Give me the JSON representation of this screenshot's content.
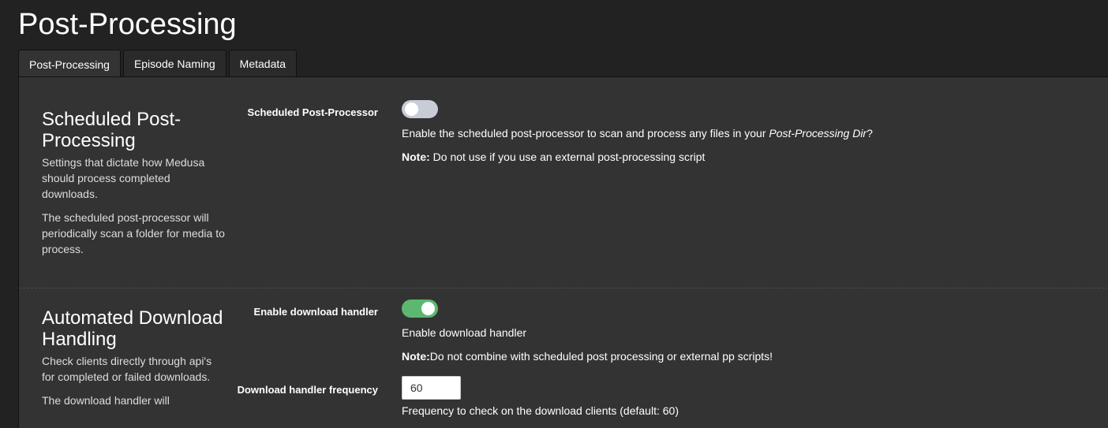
{
  "page": {
    "title": "Post-Processing"
  },
  "tabs": [
    {
      "label": "Post-Processing",
      "active": true
    },
    {
      "label": "Episode Naming",
      "active": false
    },
    {
      "label": "Metadata",
      "active": false
    }
  ],
  "scheduled": {
    "title": "Scheduled Post-Processing",
    "desc1": "Settings that dictate how Medusa should process completed downloads.",
    "desc2": "The scheduled post-processor will periodically scan a folder for media to process.",
    "toggle_label": "Scheduled Post-Processor",
    "toggle_on": false,
    "help_prefix": "Enable the scheduled post-processor to scan and process any files in your ",
    "help_em": "Post-Processing Dir",
    "help_suffix": "?",
    "note_label": "Note:",
    "note_text": " Do not use if you use an external post-processing script"
  },
  "automated": {
    "title": "Automated Download Handling",
    "desc1": "Check clients directly through api's for completed or failed downloads.",
    "desc2": "The download handler will",
    "toggle_label": "Enable download handler",
    "toggle_on": true,
    "help": "Enable download handler",
    "note_label": "Note:",
    "note_text": "Do not combine with scheduled post processing or external pp scripts!",
    "frequency_label": "Download handler frequency",
    "frequency_value": "60",
    "frequency_help": "Frequency to check on the download clients (default: 60)"
  },
  "colors": {
    "background": "#222222",
    "panel": "#333333",
    "toggle_off": "#c7ccd6",
    "toggle_on": "#5cb870"
  }
}
